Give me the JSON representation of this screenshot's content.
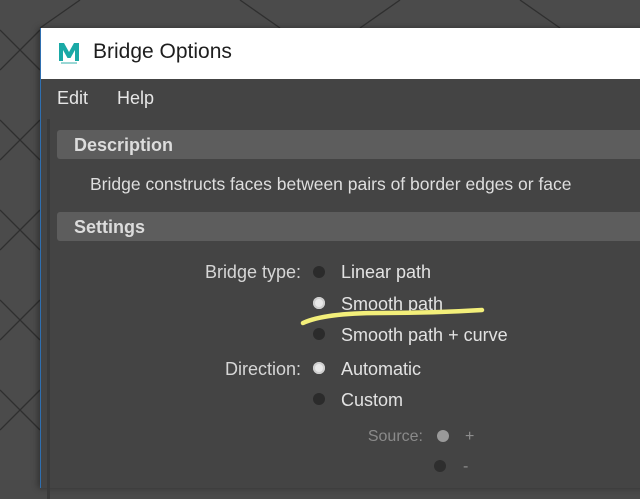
{
  "window": {
    "title": "Bridge Options"
  },
  "menubar": {
    "items": [
      "Edit",
      "Help"
    ]
  },
  "description": {
    "header": "Description",
    "text": "Bridge constructs faces between pairs of border edges or face"
  },
  "settings": {
    "header": "Settings",
    "bridge_type": {
      "label": "Bridge type:",
      "options": [
        "Linear path",
        "Smooth path",
        "Smooth path + curve"
      ],
      "selected": "Smooth path"
    },
    "direction": {
      "label": "Direction:",
      "options": [
        "Automatic",
        "Custom"
      ],
      "selected": "Automatic"
    },
    "source": {
      "label": "Source:",
      "options": [
        "+",
        "-"
      ],
      "selected": "+",
      "enabled": false
    }
  },
  "annotation": {
    "highlight_color": "#f3ef7a"
  },
  "app_icon": {
    "name": "maya-icon",
    "letter": "M",
    "color": "#1aa9a6"
  }
}
